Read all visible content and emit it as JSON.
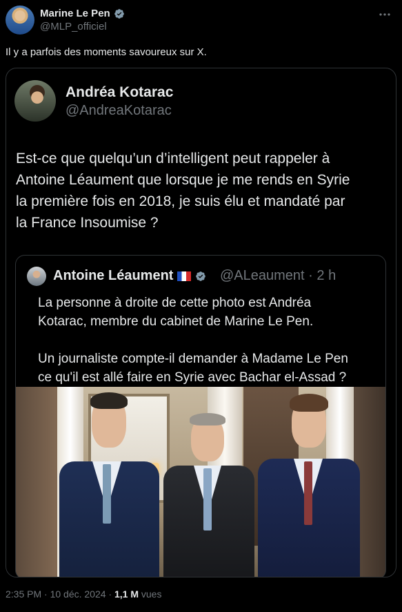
{
  "tweet": {
    "author_name": "Marine Le Pen",
    "author_handle": "@MLP_officiel",
    "more_icon": "more-icon",
    "text": "Il y a parfois des moments savoureux sur X.",
    "timestamp": "2:35 PM · 10 déc. 2024 ·",
    "views_count": "1,1 M",
    "views_label": "vues"
  },
  "quoted": {
    "author_name": "Andréa Kotarac",
    "author_handle": "@AndreaKotarac",
    "text": "Est-ce que quelqu’un d’intelligent peut rappeler à\nAntoine Léaument que lorsque je me rends en Syrie\nla première fois en 2018, je suis élu et mandaté par\nla France Insoumise ?",
    "inner": {
      "author_name": "Antoine Léaument",
      "author_handle": "@ALeaument",
      "time": "· 2 h",
      "text": "La personne à droite de cette photo est Andréa\nKotarac, membre du cabinet de Marine Le Pen.\n\nUn journaliste compte-il demander à Madame Le Pen\nce qu'il est allé faire en Syrie avec Bachar el-Assad ?"
    }
  },
  "colors": {
    "background": "#000000",
    "text_primary": "#e7e9ea",
    "text_secondary": "#71767b",
    "border": "#2f3336",
    "verified_badge": "#829aab"
  }
}
